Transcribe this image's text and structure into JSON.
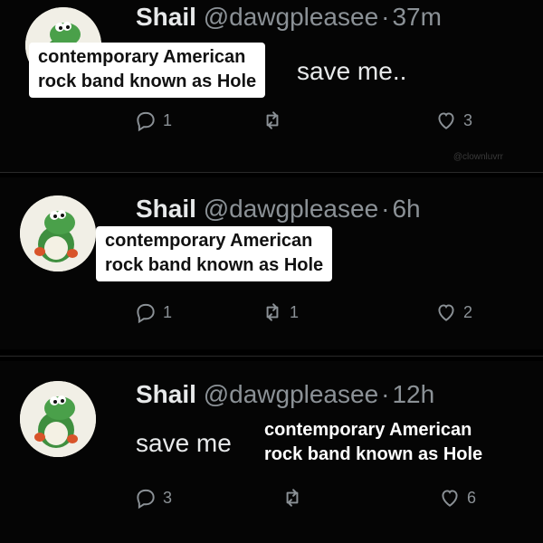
{
  "watermark": "@clownluvrr",
  "tweets": [
    {
      "name": "Shail",
      "handle": "@dawgpleasee",
      "separator": "·",
      "time": "37m",
      "text": "save me..",
      "overlay": "contemporary American\nrock band known as Hole",
      "replies": "1",
      "retweets": "",
      "likes": "3"
    },
    {
      "name": "Shail",
      "handle": "@dawgpleasee",
      "separator": "·",
      "time": "6h",
      "text": "",
      "overlay": "contemporary American\nrock band known as Hole",
      "replies": "1",
      "retweets": "1",
      "likes": "2"
    },
    {
      "name": "Shail",
      "handle": "@dawgpleasee",
      "separator": "·",
      "time": "12h",
      "text": "save me",
      "overlay": "contemporary American\nrock band known as Hole",
      "replies": "3",
      "retweets": "",
      "likes": "6"
    }
  ],
  "icons": {
    "reply": "reply-icon",
    "retweet": "retweet-icon",
    "like": "heart-icon"
  },
  "colors": {
    "background": "#000000",
    "text": "#e7e9ea",
    "muted": "#8b9196",
    "overlay_bg": "#ffffff",
    "avatar_green": "#3f8f3f"
  }
}
